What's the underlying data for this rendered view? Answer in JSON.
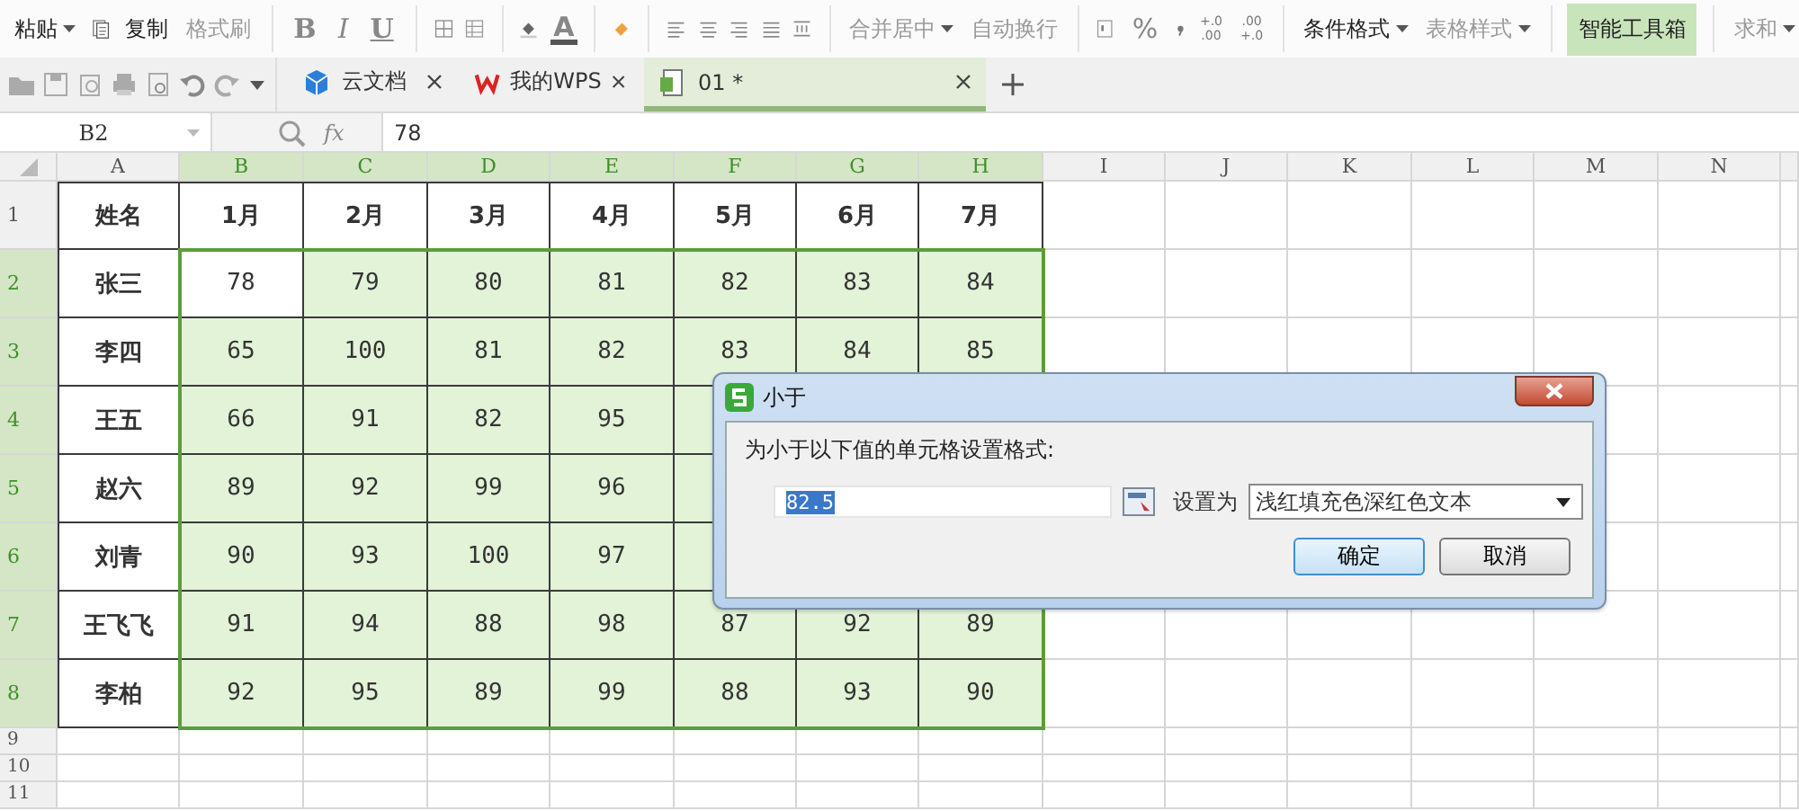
{
  "ribbon": {
    "paste": {
      "label": "粘贴",
      "disabled": false
    },
    "copy": {
      "label": "复制",
      "disabled": false
    },
    "format_painter": {
      "label": "格式刷",
      "disabled": true
    },
    "bold": {
      "label": "B"
    },
    "italic": {
      "label": "I"
    },
    "underline": {
      "label": "U"
    },
    "font_color": {
      "label": "A"
    },
    "merge_center": {
      "label": "合并居中",
      "disabled": true
    },
    "wrap_text": {
      "label": "自动换行",
      "disabled": true
    },
    "percent": {
      "label": "%"
    },
    "add_decimal": {
      "top": "+.0",
      "bottom": ".00"
    },
    "remove_decimal": {
      "top": ".00",
      "bottom": "+.0"
    },
    "conditional_format": {
      "label": "条件格式",
      "disabled": false
    },
    "table_style": {
      "label": "表格样式",
      "disabled": true
    },
    "smart_toolbox": {
      "label": "智能工具箱",
      "highlighted": true
    },
    "sum": {
      "label": "求和",
      "disabled": true
    }
  },
  "tabs": [
    {
      "label": "云文档",
      "selected": false
    },
    {
      "label": "我的WPS",
      "selected": false
    },
    {
      "label": "01 *",
      "selected": true
    }
  ],
  "formula_bar": {
    "name_box": "B2",
    "function_label": "fx",
    "formula": "78"
  },
  "sheet": {
    "columns": [
      {
        "label": "A",
        "selected": false
      },
      {
        "label": "B",
        "selected": true
      },
      {
        "label": "C",
        "selected": true
      },
      {
        "label": "D",
        "selected": true
      },
      {
        "label": "E",
        "selected": true
      },
      {
        "label": "F",
        "selected": true
      },
      {
        "label": "G",
        "selected": true
      },
      {
        "label": "H",
        "selected": true
      },
      {
        "label": "I",
        "selected": false
      },
      {
        "label": "J",
        "selected": false
      },
      {
        "label": "K",
        "selected": false
      },
      {
        "label": "L",
        "selected": false
      },
      {
        "label": "M",
        "selected": false
      },
      {
        "label": "N",
        "selected": false
      }
    ],
    "rows": [
      {
        "number": "1",
        "selected": false,
        "cells": [
          "姓名",
          "1月",
          "2月",
          "3月",
          "4月",
          "5月",
          "6月",
          "7月"
        ]
      },
      {
        "number": "2",
        "selected": true,
        "cells": [
          "张三",
          "78",
          "79",
          "80",
          "81",
          "82",
          "83",
          "84"
        ]
      },
      {
        "number": "3",
        "selected": true,
        "cells": [
          "李四",
          "65",
          "100",
          "81",
          "82",
          "83",
          "84",
          "85"
        ]
      },
      {
        "number": "4",
        "selected": true,
        "cells": [
          "王五",
          "66",
          "91",
          "82",
          "95"
        ]
      },
      {
        "number": "5",
        "selected": true,
        "cells": [
          "赵六",
          "89",
          "92",
          "99",
          "96"
        ]
      },
      {
        "number": "6",
        "selected": true,
        "cells": [
          "刘青",
          "90",
          "93",
          "100",
          "97"
        ]
      },
      {
        "number": "7",
        "selected": true,
        "cells": [
          "王飞飞",
          "91",
          "94",
          "88",
          "98",
          "87",
          "92",
          "89"
        ]
      },
      {
        "number": "8",
        "selected": true,
        "cells": [
          "李柏",
          "92",
          "95",
          "89",
          "99",
          "88",
          "93",
          "90"
        ]
      },
      {
        "number": "9",
        "selected": false
      },
      {
        "number": "10",
        "selected": false
      },
      {
        "number": "11",
        "selected": false
      }
    ]
  },
  "dialog": {
    "title": "小于",
    "prompt": "为小于以下值的单元格设置格式:",
    "value": "82.5",
    "value_selected": true,
    "set_as_label": "设置为",
    "format_option": "浅红填充色深红色文本",
    "buttons": [
      {
        "label": "确定",
        "default": true
      },
      {
        "label": "取消",
        "default": false
      }
    ]
  }
}
